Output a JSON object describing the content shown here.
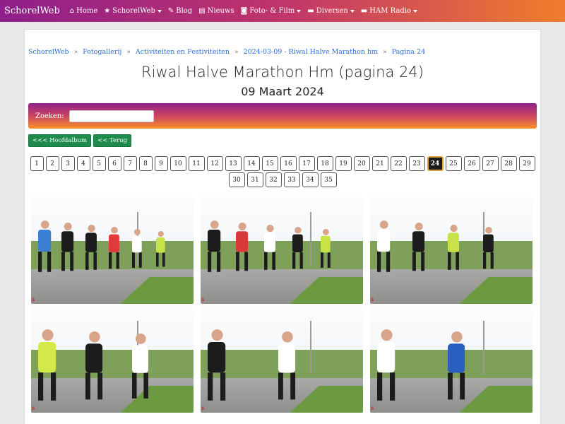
{
  "navbar": {
    "brand": "SchorelWeb",
    "items": [
      {
        "label": "Home",
        "icon": "home-icon",
        "glyph": "⌂",
        "dropdown": false
      },
      {
        "label": "SchorelWeb",
        "icon": "star-icon",
        "glyph": "★",
        "dropdown": true
      },
      {
        "label": "Blog",
        "icon": "pencil-icon",
        "glyph": "✎",
        "dropdown": false
      },
      {
        "label": "Nieuws",
        "icon": "newspaper-icon",
        "glyph": "▤",
        "dropdown": false
      },
      {
        "label": "Foto- & Film",
        "icon": "camera-icon",
        "glyph": "◙",
        "dropdown": true
      },
      {
        "label": "Diversen",
        "icon": "folder-icon",
        "glyph": "▬",
        "dropdown": true
      },
      {
        "label": "HAM Radio",
        "icon": "folder-icon",
        "glyph": "▬",
        "dropdown": true
      }
    ]
  },
  "breadcrumb": [
    "SchorelWeb",
    "Fotogallerij",
    "Activiteiten en Festiviteiten",
    "2024-03-09 - Riwal Halve Marathon hm",
    "Pagina 24"
  ],
  "breadcrumb_separator": "»",
  "page": {
    "title": "Riwal Halve Marathon Hm (pagina 24)",
    "subtitle": "09 Maart 2024"
  },
  "search": {
    "label": "Zoeken:",
    "value": ""
  },
  "buttons": {
    "main_album": "<<< Hoofdalbum",
    "back": "<< Terug"
  },
  "pagination": {
    "pages": [
      "1",
      "2",
      "3",
      "4",
      "5",
      "6",
      "7",
      "8",
      "9",
      "10",
      "11",
      "12",
      "13",
      "14",
      "15",
      "16",
      "17",
      "18",
      "19",
      "20",
      "21",
      "22",
      "23",
      "24",
      "25",
      "26",
      "27",
      "28",
      "29",
      "30",
      "31",
      "32",
      "33",
      "34",
      "35"
    ],
    "current": "24"
  },
  "gallery": {
    "photo_count_visible": 6,
    "watermark": "S"
  }
}
